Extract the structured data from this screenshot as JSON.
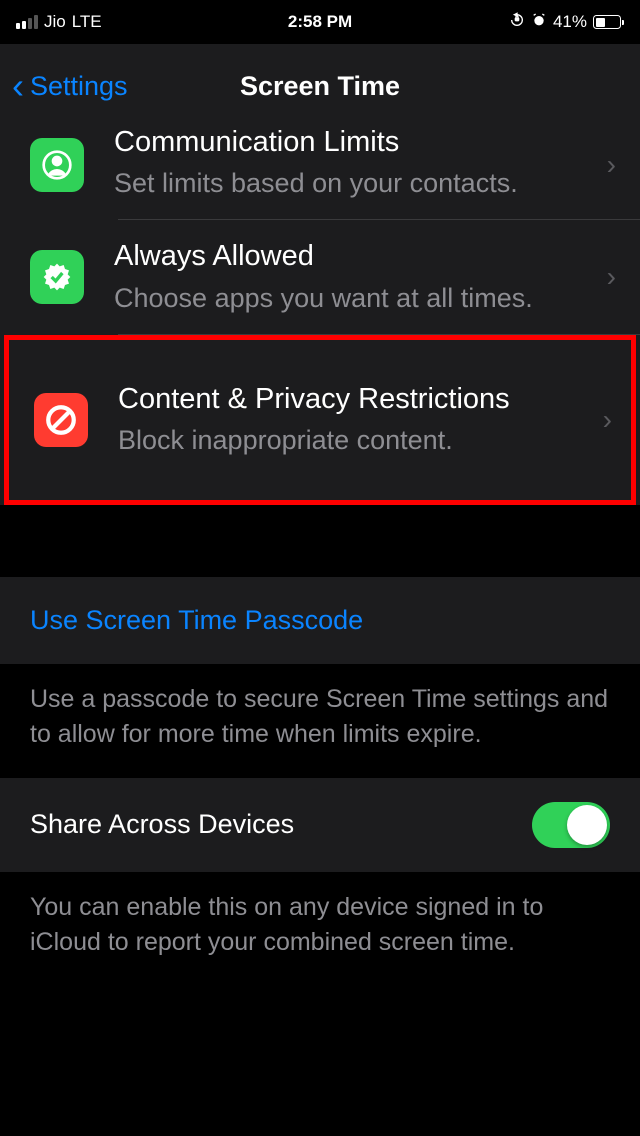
{
  "status": {
    "carrier": "Jio",
    "network": "LTE",
    "time": "2:58 PM",
    "battery_pct": "41%"
  },
  "nav": {
    "back_label": "Settings",
    "title": "Screen Time"
  },
  "rows": {
    "comm": {
      "title": "Communication Limits",
      "sub": "Set limits based on your contacts."
    },
    "always": {
      "title": "Always Allowed",
      "sub": "Choose apps you want at all times."
    },
    "content": {
      "title": "Content & Privacy Restrictions",
      "sub": "Block inappropriate content."
    }
  },
  "passcode": {
    "action": "Use Screen Time Passcode",
    "footer": "Use a passcode to secure Screen Time settings and to allow for more time when limits expire."
  },
  "share": {
    "label": "Share Across Devices",
    "footer": "You can enable this on any device signed in to iCloud to report your combined screen time."
  }
}
